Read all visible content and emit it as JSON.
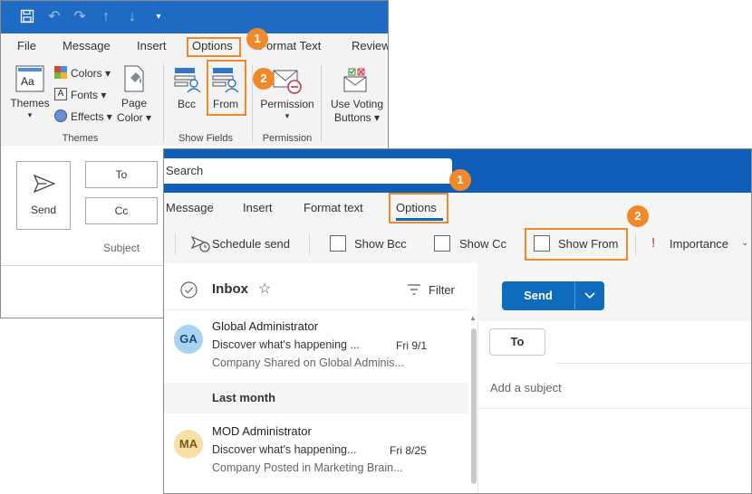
{
  "classic": {
    "tabs": [
      "File",
      "Message",
      "Insert",
      "Options",
      "Format Text",
      "Review"
    ],
    "ribbon": {
      "themes": {
        "line1": "Themes",
        "line2": "▾"
      },
      "colors": "Colors ▾",
      "fonts": "Fonts ▾",
      "effects": "Effects ▾",
      "page_color": {
        "line1": "Page",
        "line2": "Color ▾"
      },
      "bcc": "Bcc",
      "from": "From",
      "permission": {
        "line1": "Permission",
        "line2": "▾"
      },
      "voting": {
        "line1": "Use Voting",
        "line2": "Buttons ▾"
      },
      "groups": {
        "themes": "Themes",
        "show_fields": "Show Fields",
        "permission": "Permission"
      }
    },
    "compose": {
      "send": "Send",
      "to": "To",
      "cc": "Cc",
      "subject": "Subject"
    },
    "badges": {
      "one": "1",
      "two": "2"
    }
  },
  "new_outlook": {
    "search_placeholder": "Search",
    "tabs": [
      "Message",
      "Insert",
      "Format text",
      "Options"
    ],
    "toolbar": {
      "schedule_send": "Schedule send",
      "show_bcc": "Show Bcc",
      "show_cc": "Show Cc",
      "show_from": "Show From",
      "importance": "Importance"
    },
    "inbox": {
      "title": "Inbox",
      "filter": "Filter",
      "section": "Last month"
    },
    "messages": [
      {
        "initials": "GA",
        "sender": "Global Administrator",
        "subject": "Discover what's happening ...",
        "date": "Fri 9/1",
        "preview": "Company Shared on Global Adminis..."
      },
      {
        "initials": "MA",
        "sender": "MOD Administrator",
        "subject": "Discover what's happening...",
        "date": "Fri 8/25",
        "preview": "Company Posted in Marketing Brain..."
      }
    ],
    "compose": {
      "send": "Send",
      "to": "To",
      "subject_placeholder": "Add a subject"
    },
    "badges": {
      "one": "1",
      "two": "2"
    }
  },
  "colors": {
    "accent_blue": "#0f6cbd",
    "title_blue": "#1f6bc4",
    "highlight_orange": "#f0892a",
    "avatar_ga_bg": "#a9d3f0",
    "avatar_ma_bg": "#f7dfa6"
  }
}
